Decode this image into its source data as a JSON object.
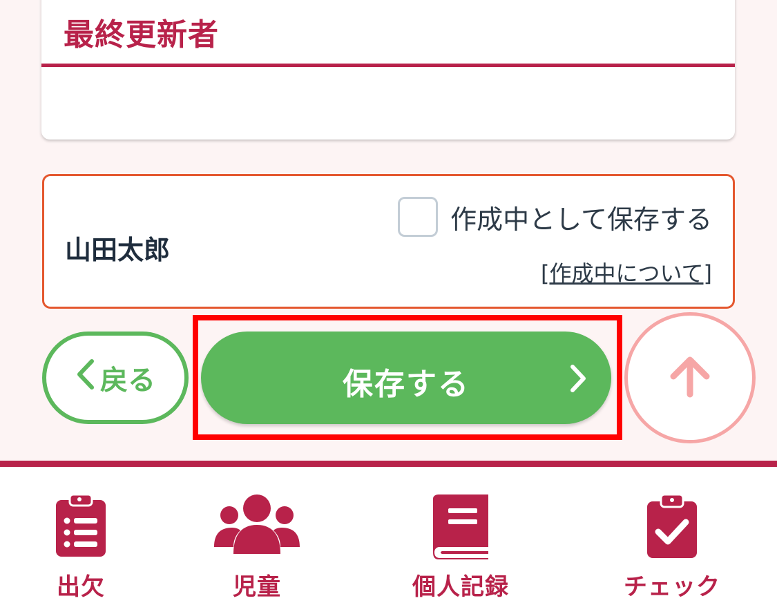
{
  "updater_card": {
    "title": "最終更新者"
  },
  "author": {
    "name": "山田太郎",
    "draft_checkbox_label": "作成中として保存する",
    "about_link_open": "[",
    "about_link": "作成中について",
    "about_link_close": "]"
  },
  "actions": {
    "back_label": "戻る",
    "save_label": "保存する"
  },
  "bottom_nav": {
    "items": [
      {
        "label": "出欠",
        "icon": "clipboard-list-icon"
      },
      {
        "label": "児童",
        "icon": "users-icon"
      },
      {
        "label": "個人記録",
        "icon": "book-icon"
      },
      {
        "label": "チェック",
        "icon": "clipboard-check-icon"
      }
    ]
  },
  "colors": {
    "brand": "#b8224a",
    "save_green": "#5cb85c",
    "author_border": "#e4572e",
    "highlight_red": "#ff0000",
    "scroll_up_pink": "#f6a6a6"
  }
}
